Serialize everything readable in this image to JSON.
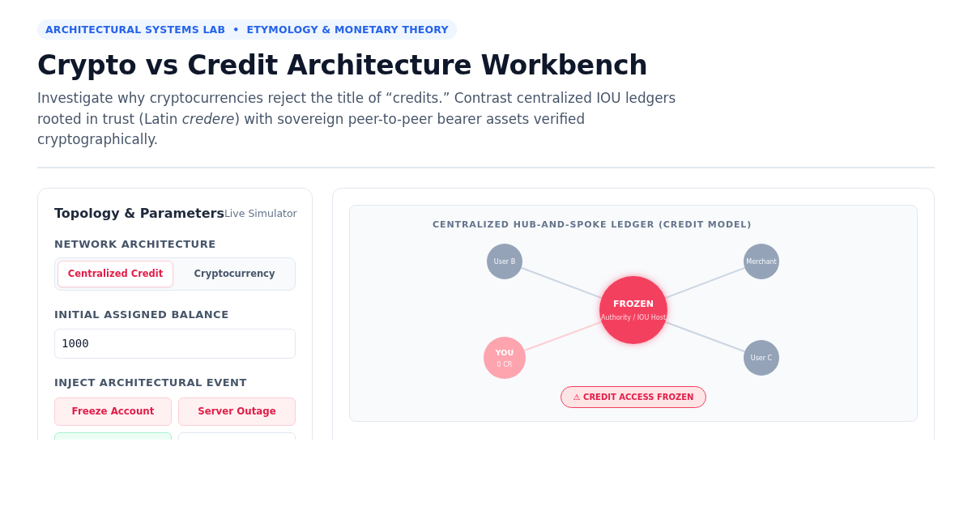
{
  "header": {
    "badge": "ARCHITECTURAL SYSTEMS LAB  •  ETYMOLOGY & MONETARY THEORY",
    "title": "Crypto vs Credit Architecture Workbench",
    "subtitle": "Investigate why cryptocurrencies reject the title of “credits.” Contrast centralized IOU ledgers rooted in trust (Latin *credere*) with sovereign peer-to-peer bearer assets verified cryptographically."
  },
  "controls": {
    "title": "Topology & Parameters",
    "tag": "Live Simulator",
    "architecture": {
      "label": "NETWORK ARCHITECTURE",
      "options": [
        {
          "label": "Centralized Credit",
          "selected": true
        },
        {
          "label": "Cryptocurrency",
          "selected": false
        }
      ]
    },
    "balance": {
      "label": "INITIAL ASSIGNED BALANCE",
      "value": "1000"
    },
    "events": {
      "label": "INJECT ARCHITECTURAL EVENT",
      "buttons": [
        {
          "label": "Freeze Account",
          "kind": "danger"
        },
        {
          "label": "Server Outage",
          "kind": "danger"
        },
        {
          "kind": "success"
        },
        {
          "kind": "neutral"
        }
      ]
    }
  },
  "diagram": {
    "title": "CENTRALIZED HUB-AND-SPOKE LEDGER (CREDIT MODEL)",
    "hub": {
      "label": "FROZEN",
      "sublabel": "Authority / IOU Host",
      "frozen": true
    },
    "nodes": [
      {
        "label": "User B",
        "kind": "peer"
      },
      {
        "label": "Merchant",
        "kind": "peer"
      },
      {
        "label": "YOU",
        "sublabel": "0 CR",
        "kind": "self"
      },
      {
        "label": "User C",
        "kind": "peer"
      }
    ],
    "alert": {
      "text": "⚠ CREDIT ACCESS FROZEN"
    }
  }
}
